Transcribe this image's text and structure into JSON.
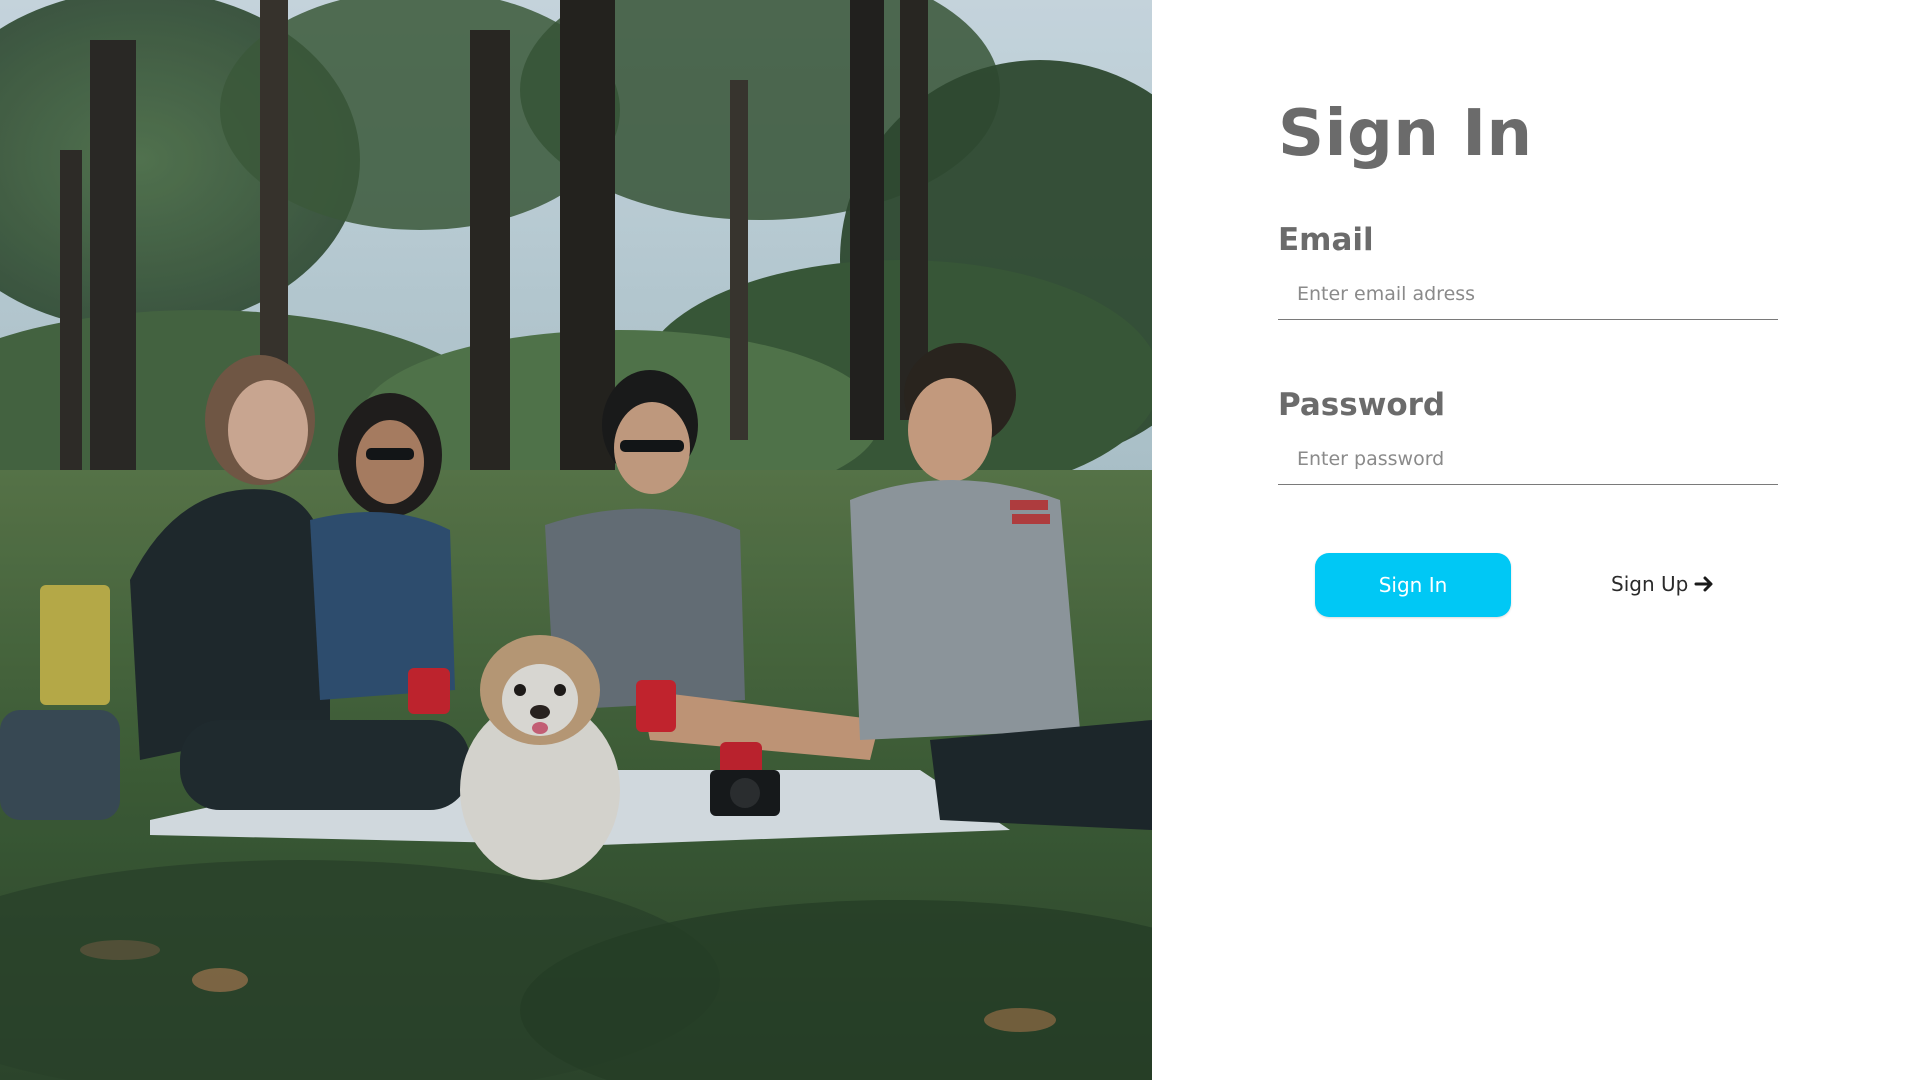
{
  "page": {
    "background": "#ffffff"
  },
  "hero_image": {
    "icon": "picnic-photo"
  },
  "form": {
    "title": "Sign In",
    "email": {
      "label": "Email",
      "placeholder": "Enter email adress",
      "value": ""
    },
    "password": {
      "label": "Password",
      "placeholder": "Enter password",
      "value": ""
    },
    "signin_button_label": "Sign In",
    "signup_link_label": "Sign Up",
    "signup_icon": "arrow-right-icon"
  },
  "colors": {
    "accent": "#00c8f5",
    "text_heading": "#6b6b6b",
    "text_link": "#2a2a2a"
  }
}
